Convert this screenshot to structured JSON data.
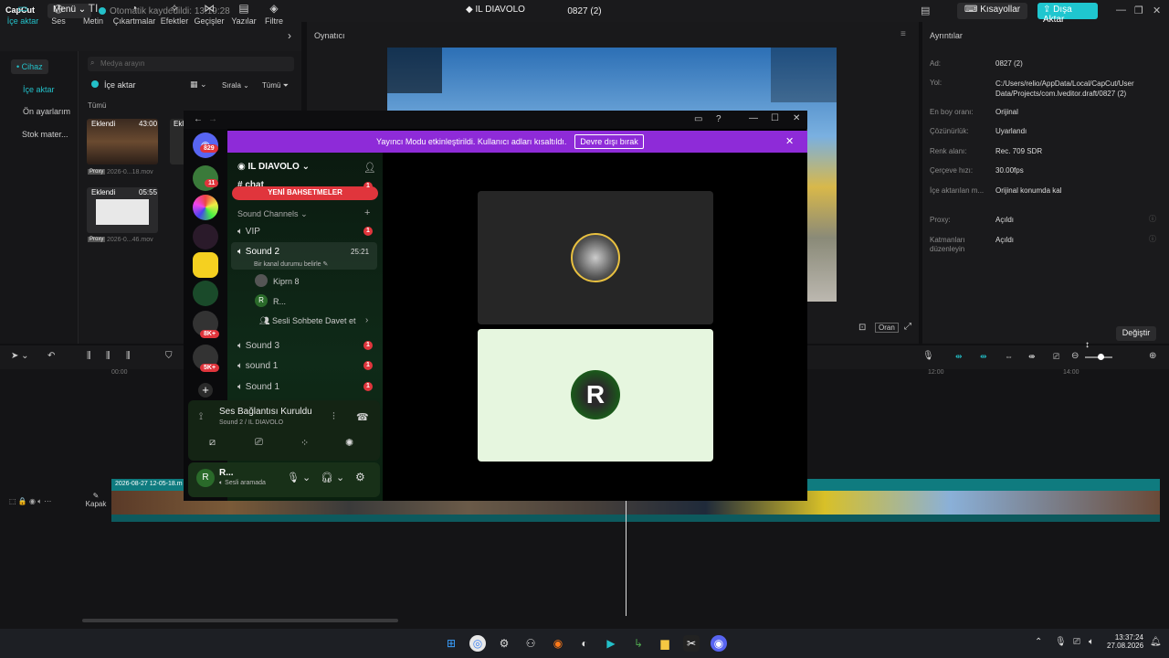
{
  "capcut": {
    "logo": "CapCut",
    "menu": "Menü",
    "autosave": "Otomatik kaydedildi: 13:19:28",
    "project_title": "0827 (2)",
    "shortcuts": "Kısayollar",
    "export": "Dışa Aktar",
    "tools": [
      "İçe aktar",
      "Ses",
      "Metin",
      "Çıkartmalar",
      "Efektler",
      "Geçişler",
      "Yazılar",
      "Filtre"
    ],
    "tool_icons": [
      "▭",
      "◷",
      "TI",
      "◔",
      "✧",
      "⋈",
      "▤",
      "◈"
    ],
    "side_nav": [
      "• Cihaz",
      "İçe aktar",
      "Ön ayarlarım",
      "Stok mater..."
    ],
    "search_placeholder": "Medya arayın",
    "import_button": "İçe aktar",
    "sort": "Sırala",
    "all_filter": "Tümü",
    "all_label": "Tümü",
    "media": [
      {
        "badge": "Eklendi",
        "duration": "43:00",
        "proxy": "Proxy",
        "name": "2026-0...18.mov"
      },
      {
        "badge": "Eklendi",
        "duration": "05:55",
        "proxy": "Proxy",
        "name": "2026-0...46.mov"
      }
    ],
    "partial_badge": "Ekl",
    "player_title": "Oynatıcı",
    "ratio_button": "Oran",
    "details_title": "Ayrıntılar",
    "details": [
      {
        "k": "Ad:",
        "v": "0827 (2)"
      },
      {
        "k": "Yol:",
        "v": "C:/Users/relio/AppData/Local/CapCut/User Data/Projects/com.lveditor.draft/0827 (2)"
      },
      {
        "k": "En boy oranı:",
        "v": "Orijinal"
      },
      {
        "k": "Çözünürlük:",
        "v": "Uyarlandı"
      },
      {
        "k": "Renk alanı:",
        "v": "Rec. 709 SDR"
      },
      {
        "k": "Çerçeve hızı:",
        "v": "30.00fps"
      },
      {
        "k": "İçe aktarılan m...",
        "v": "Orijinal konumda kal"
      },
      {
        "k": "Proxy:",
        "v": "Açıldı"
      },
      {
        "k": "Katmanları düzenleyin",
        "v": "Açıldı"
      }
    ],
    "change_button": "Değiştir",
    "ruler": [
      "00:00",
      "12:00",
      "14:00"
    ],
    "clip_name": "2026-08-27 12-05-18.m",
    "cover": "Kapak"
  },
  "discord": {
    "window_title": "IL DIAVOLO",
    "banner_text": "Yayıncı Modu etkinleştirildi. Kullanıcı adları kısaltıldı.",
    "banner_button": "Devre dışı bırak",
    "server_name": "IL DIAVOLO",
    "partial_channel": "chat",
    "new_mentions": "YENİ BAHSETMELER",
    "category": "Sound Channels",
    "guild_badges": [
      "829",
      "11",
      "8K+",
      "5K+"
    ],
    "channels": [
      {
        "name": "VIP",
        "badge": "1"
      },
      {
        "name": "Sound 2",
        "time": "25:21",
        "status": "Bir kanal durumu belirle"
      },
      {
        "name": "Sound 3",
        "badge": "1"
      },
      {
        "name": "sound 1",
        "badge": "1"
      },
      {
        "name": "Sound 1",
        "badge": "1"
      }
    ],
    "channel_badge_top": "1",
    "members": [
      "Kiprn 8",
      "R..."
    ],
    "invite_row": "Sesli Sohbete Davet et",
    "voice_status": "Ses Bağlantısı Kuruldu",
    "voice_sub": "Sound 2 / IL DIAVOLO",
    "user_name": "R...",
    "user_status": "Sesli aramada"
  },
  "taskbar": {
    "time": "13:37:24",
    "date": "27.08.2026"
  },
  "colors": {
    "accent": "#1fc6cf",
    "discord_banner": "#8e2bd8",
    "mention_red": "#e0353c"
  }
}
